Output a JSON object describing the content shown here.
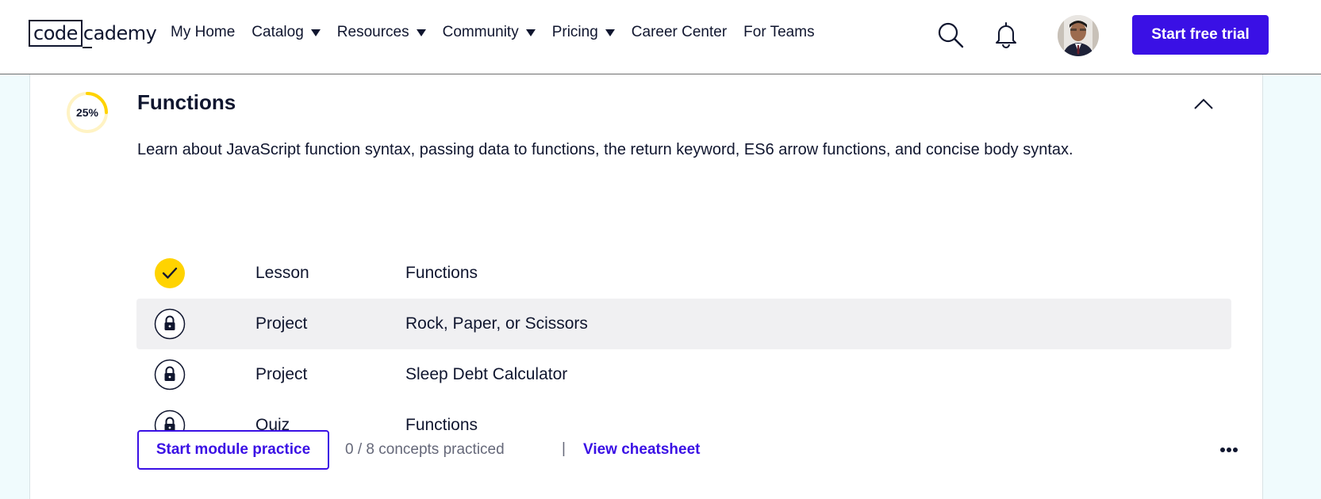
{
  "header": {
    "logo": {
      "box_text": "code",
      "rest_text": "cademy"
    },
    "nav": [
      {
        "label": "My Home",
        "has_caret": false
      },
      {
        "label": "Catalog",
        "has_caret": true
      },
      {
        "label": "Resources",
        "has_caret": true
      },
      {
        "label": "Community",
        "has_caret": true
      },
      {
        "label": "Pricing",
        "has_caret": true
      },
      {
        "label": "Career Center",
        "has_caret": false
      },
      {
        "label": "For Teams",
        "has_caret": false
      }
    ],
    "icons": [
      "search-icon",
      "bell-icon"
    ],
    "cta_label": "Start free trial"
  },
  "module": {
    "progress_text": "25%",
    "progress_value": 0.25,
    "title": "Functions",
    "description": "Learn about JavaScript function syntax, passing data to functions, the return keyword, ES6 arrow functions, and concise body syntax.",
    "items": [
      {
        "status": "completed",
        "icon": "check-icon",
        "type": "Lesson",
        "name": "Functions"
      },
      {
        "status": "locked",
        "icon": "lock-icon",
        "type": "Project",
        "name": "Rock, Paper, or Scissors"
      },
      {
        "status": "locked",
        "icon": "lock-icon",
        "type": "Project",
        "name": "Sleep Debt Calculator"
      },
      {
        "status": "locked",
        "icon": "lock-icon",
        "type": "Quiz",
        "name": "Functions"
      }
    ],
    "footer": {
      "practice_label": "Start module practice",
      "concepts_text": "0 / 8 concepts practiced",
      "separator": "|",
      "cheatsheet_label": "View cheatsheet"
    }
  },
  "colors": {
    "brand": "#3a10e5",
    "progress": "#ffd300",
    "progress_track": "#fff3c4",
    "text": "#10162f",
    "background": "#f0fbfd"
  }
}
